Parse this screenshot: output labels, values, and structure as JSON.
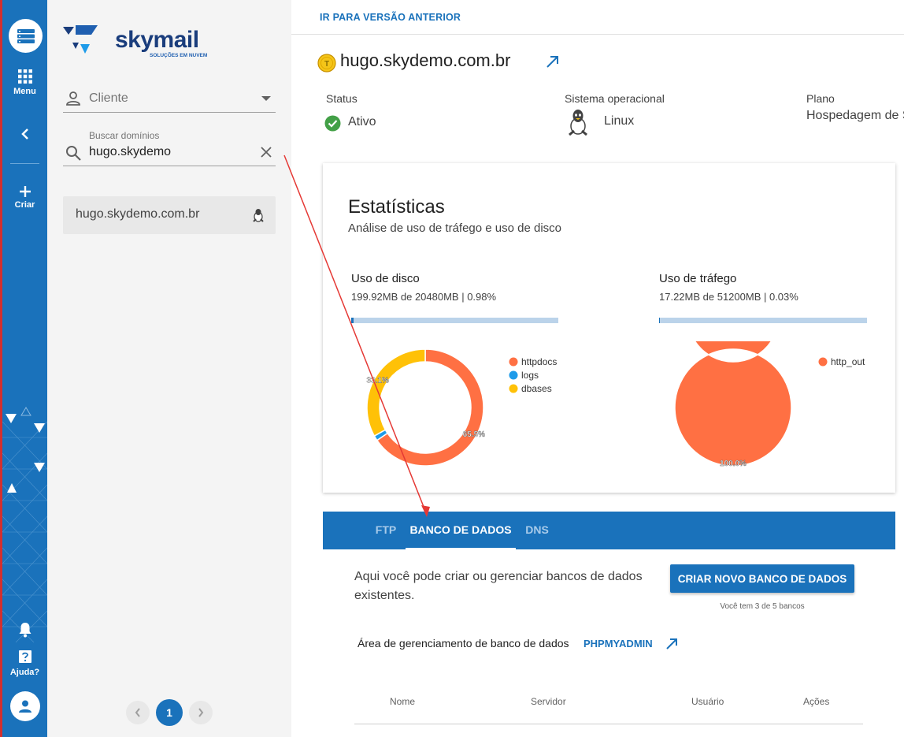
{
  "rail": {
    "menu_label": "Menu",
    "create_label": "Criar",
    "help_label": "Ajuda?"
  },
  "sidebar": {
    "brand_name": "skymail",
    "brand_tagline": "SOLUÇÕES EM NUVEM",
    "client_placeholder": "Cliente",
    "search_label": "Buscar domínios",
    "search_value": "hugo.skydemo",
    "domains": [
      {
        "name": "hugo.skydemo.com.br",
        "os_icon": "linux-icon"
      }
    ],
    "pagination": {
      "current_page": "1"
    }
  },
  "topbar": {
    "previous_version_link": "IR PARA VERSÃO ANTERIOR"
  },
  "domain": {
    "title": "hugo.skydemo.com.br",
    "status_label": "Status",
    "status_value": "Ativo",
    "os_label": "Sistema operacional",
    "os_value": "Linux",
    "plan_label": "Plano",
    "plan_value": "Hospedagem de S"
  },
  "stats": {
    "title": "Estatísticas",
    "subtitle": "Análise de uso de tráfego e uso de disco",
    "disk": {
      "title": "Uso de disco",
      "summary": "199.92MB de 20480MB | 0.98%",
      "used_fraction": 0.0098
    },
    "traffic": {
      "title": "Uso de tráfego",
      "summary": "17.22MB de 51200MB | 0.03%",
      "used_fraction": 0.0003
    }
  },
  "chart_data": [
    {
      "type": "pie",
      "categories": [
        "httpdocs",
        "logs",
        "dbases"
      ],
      "values": [
        65.5,
        1.4,
        33.1
      ],
      "labels": [
        "65.5%",
        "",
        "33.1%"
      ],
      "colors": [
        "#ff7043",
        "#1e9be9",
        "#ffc107"
      ],
      "legend": "right"
    },
    {
      "type": "pie",
      "categories": [
        "http_out"
      ],
      "values": [
        100.0
      ],
      "labels": [
        "100.0%"
      ],
      "colors": [
        "#ff7043"
      ],
      "legend": "right"
    }
  ],
  "tabs": [
    {
      "label": "FTP",
      "active": false
    },
    {
      "label": "BANCO DE DADOS",
      "active": true
    },
    {
      "label": "DNS",
      "active": false
    }
  ],
  "database": {
    "description": "Aqui você pode criar ou gerenciar bancos de dados existentes.",
    "create_button": "CRIAR NOVO BANCO DE DADOS",
    "quota": "Você tem 3 de 5 bancos",
    "management_label": "Área de gerenciamento de banco de dados",
    "phpmyadmin_link": "PHPMYADMIN",
    "columns": [
      "Nome",
      "Servidor",
      "Usuário",
      "Ações"
    ]
  }
}
